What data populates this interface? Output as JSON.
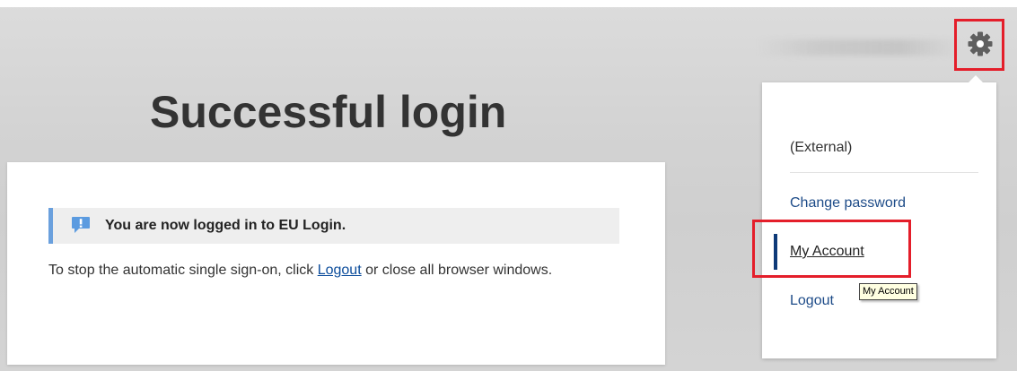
{
  "page": {
    "title": "Successful login"
  },
  "notice": {
    "text": "You are now logged in to EU Login.",
    "icon": "exclamation-speech-icon",
    "accent_color": "#6aa0dd"
  },
  "info": {
    "before_link": "To stop the automatic single sign-on, click ",
    "link_text": "Logout",
    "after_link": " or close all browser windows."
  },
  "user_menu": {
    "trigger_icon": "gear-icon",
    "user_label": "(External)",
    "items": [
      {
        "label": "Change password"
      },
      {
        "label": "My Account",
        "active": true
      },
      {
        "label": "Logout"
      }
    ]
  },
  "tooltip": {
    "text": "My Account"
  },
  "colors": {
    "highlight_red": "#e41e2a",
    "link_blue": "#1d4b88",
    "active_bar": "#0e3a78"
  }
}
